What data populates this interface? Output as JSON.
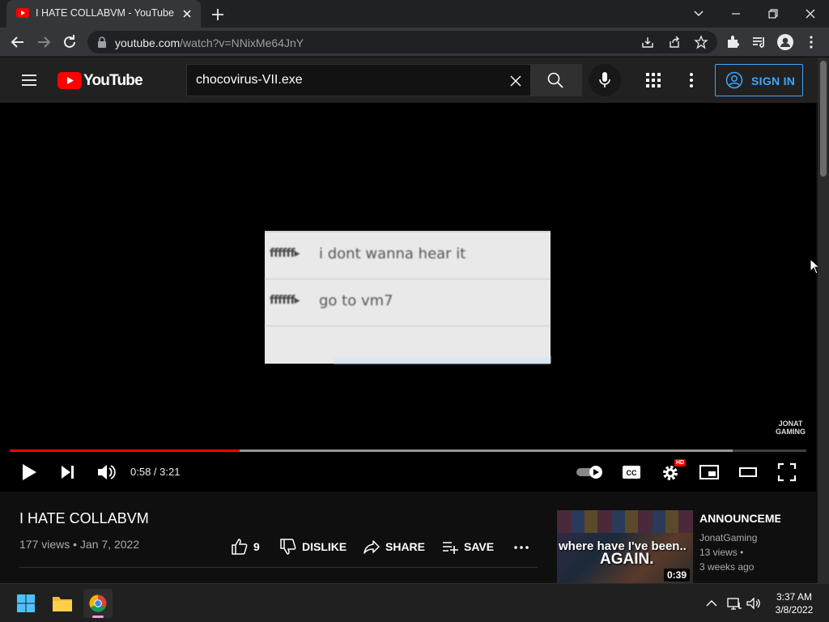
{
  "browser": {
    "tab_title": "I HATE COLLABVM - YouTube",
    "url_host": "youtube.com",
    "url_path": "/watch?v=NNixMe64JnY"
  },
  "youtube": {
    "logo_text": "YouTube",
    "search_query": "chocovirus-VII.exe",
    "signin_label": "SIGN IN"
  },
  "player": {
    "chat_lines": [
      {
        "user": "ffffff▸",
        "message": "i dont wanna hear it"
      },
      {
        "user": "ffffff▸",
        "message": "go to vm7"
      }
    ],
    "watermark": "JONAT\nGAMING",
    "time": "0:58 / 3:21",
    "progress_played": 0.2886,
    "progress_buffered": 0.908,
    "settings_badge": "HD"
  },
  "video": {
    "title": "I HATE COLLABVM",
    "meta": "177 views • Jan 7, 2022",
    "like_count": "9",
    "dislike_label": "DISLIKE",
    "share_label": "SHARE",
    "save_label": "SAVE"
  },
  "recommendation": {
    "thumb_line1": "where have I've been..",
    "thumb_line2": "AGAIN.",
    "duration": "0:39",
    "title": "ANNOUNCEMENT",
    "channel": "JonatGaming",
    "views": "13 views •",
    "age": "3 weeks ago"
  },
  "taskbar": {
    "time": "3:37 AM",
    "date": "3/8/2022"
  },
  "colors": {
    "accent_red": "#ff0000",
    "link_blue": "#3ea6ff"
  }
}
